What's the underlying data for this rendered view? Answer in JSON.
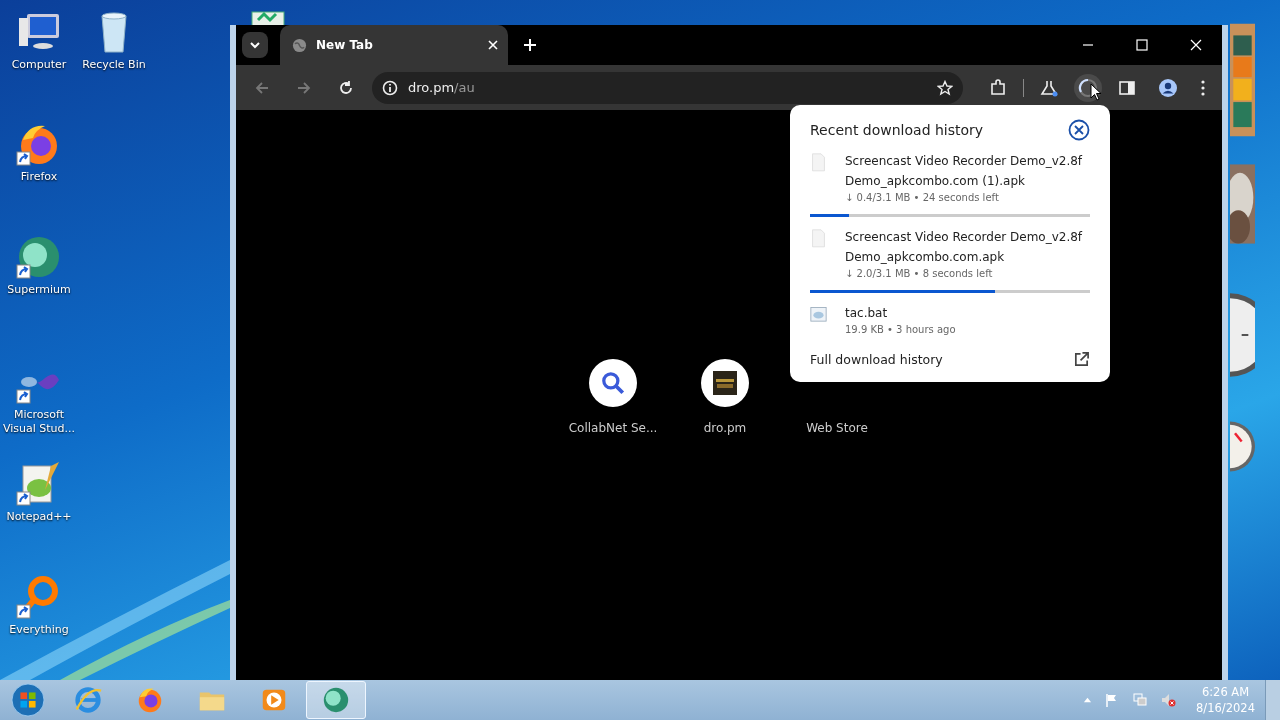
{
  "desktop_icons": [
    {
      "label": "Computer",
      "kind": "computer",
      "shortcut": false
    },
    {
      "label": "Recycle Bin",
      "kind": "bin",
      "shortcut": false
    },
    {
      "label": "Firefox",
      "kind": "firefox",
      "shortcut": true
    },
    {
      "label": "Supermium",
      "kind": "supermium",
      "shortcut": true
    },
    {
      "label": "Microsoft Visual Stud...",
      "kind": "vs",
      "shortcut": true
    },
    {
      "label": "Notepad++",
      "kind": "notepad",
      "shortcut": true
    },
    {
      "label": "Everything",
      "kind": "everything",
      "shortcut": true
    }
  ],
  "browser": {
    "tabs": [
      {
        "title": "New Tab",
        "selected": true
      }
    ],
    "nav": [
      {
        "kind": "back",
        "disabled": true
      },
      {
        "kind": "forward",
        "disabled": true
      },
      {
        "kind": "reload",
        "disabled": false
      }
    ],
    "address": {
      "host": "dro.pm",
      "path": "/au"
    },
    "shortcuts": [
      {
        "label": "CollabNet Se...",
        "kind": "search"
      },
      {
        "label": "dro.pm",
        "kind": "thumbnail"
      },
      {
        "label": "Web Store",
        "kind": "covered"
      }
    ],
    "downloads": {
      "title": "Recent download history",
      "footer": "Full download history",
      "items": [
        {
          "name": "Screencast Video Recorder Demo_v2.8f Demo_apkcombo.com (1).apk",
          "status": "↓ 0.4/3.1 MB • 24 seconds left",
          "kind": "in_progress",
          "level": 0.14
        },
        {
          "name": "Screencast Video Recorder Demo_v2.8f Demo_apkcombo.com.apk",
          "status": "↓ 2.0/3.1 MB • 8 seconds left",
          "kind": "in_progress",
          "level": 0.66
        },
        {
          "name": "tac.bat",
          "status": "19.9 KB • 3 hours ago",
          "kind": "complete"
        }
      ]
    }
  },
  "taskbar": {
    "apps": [
      {
        "kind": "ie",
        "selected": false
      },
      {
        "kind": "firefox",
        "selected": false
      },
      {
        "kind": "explorer",
        "selected": false
      },
      {
        "kind": "media",
        "selected": false
      },
      {
        "kind": "supermium",
        "selected": true
      }
    ],
    "time": "6:26 AM",
    "date": "8/16/2024"
  }
}
